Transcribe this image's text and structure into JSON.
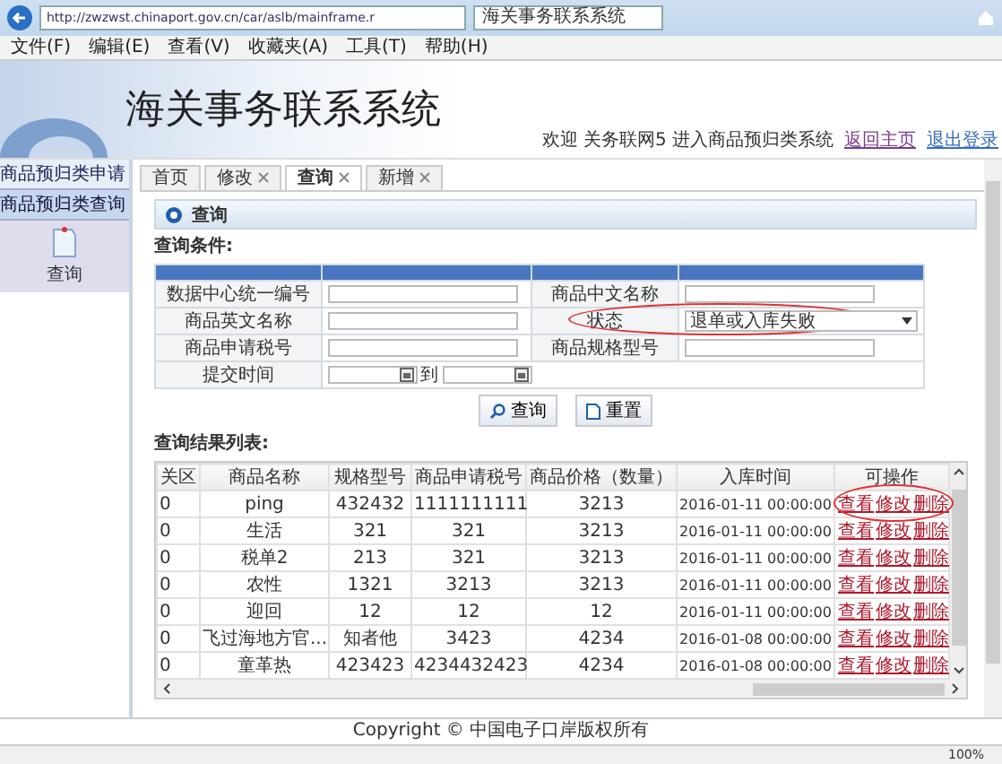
{
  "browser": {
    "url": "http://zwzwst.chinaport.gov.cn/car/aslb/mainframe.r",
    "tab_title": "海关事务联系系统",
    "menu": [
      "文件(F)",
      "编辑(E)",
      "查看(V)",
      "收藏夹(A)",
      "工具(T)",
      "帮助(H)"
    ],
    "zoom": "100%"
  },
  "header": {
    "title": "海关事务联系系统",
    "welcome": "欢迎 关务联网5 进入商品预归类系统",
    "links": [
      "返回主页",
      "退出登录"
    ]
  },
  "sidebar": {
    "items": [
      {
        "label": "商品预归类申请",
        "selected": false
      },
      {
        "label": "商品预归类查询",
        "selected": true
      }
    ],
    "tool": {
      "label": "查询"
    }
  },
  "tabs": [
    {
      "label": "首页",
      "closable": false,
      "selected": false
    },
    {
      "label": "修改",
      "closable": true,
      "selected": false
    },
    {
      "label": "查询",
      "closable": true,
      "selected": true
    },
    {
      "label": "新增",
      "closable": true,
      "selected": false
    }
  ],
  "panel_title": "查询",
  "form": {
    "title": "查询条件:",
    "rows": [
      {
        "cells": [
          {
            "label": "数据中心统一编号",
            "kind": "text",
            "circled": false
          },
          {
            "label": "商品中文名称",
            "kind": "text",
            "circled": false
          }
        ]
      },
      {
        "cells": [
          {
            "label": "商品英文名称",
            "kind": "text",
            "circled": false
          },
          {
            "label": "状态",
            "kind": "select",
            "value": "退单或入库失败",
            "circled": true
          }
        ]
      },
      {
        "cells": [
          {
            "label": "商品申请税号",
            "kind": "text",
            "circled": false
          },
          {
            "label": "商品规格型号",
            "kind": "text",
            "circled": false
          }
        ]
      },
      {
        "cells": [
          {
            "label": "提交时间",
            "kind": "daterange",
            "separator": "到",
            "circled": false
          }
        ]
      }
    ]
  },
  "buttons": [
    {
      "label": "查询",
      "kind": "search"
    },
    {
      "label": "重置",
      "kind": "reset"
    }
  ],
  "results": {
    "title": "查询结果列表:",
    "columns": [
      "关区",
      "商品名称",
      "规格型号",
      "商品申请税号",
      "商品价格（数量）",
      "入库时间",
      "可操作"
    ],
    "rows": [
      {
        "cells": [
          "0",
          "ping",
          "432432",
          "1111111111",
          "3213",
          "2016-01-11 00:00:00"
        ],
        "actions": [
          "查看",
          "修改",
          "删除"
        ],
        "circled": true
      },
      {
        "cells": [
          "0",
          "生活",
          "321",
          "321",
          "3213",
          "2016-01-11 00:00:00"
        ],
        "actions": [
          "查看",
          "修改",
          "删除"
        ],
        "circled": false
      },
      {
        "cells": [
          "0",
          "税单2",
          "213",
          "321",
          "3213",
          "2016-01-11 00:00:00"
        ],
        "actions": [
          "查看",
          "修改",
          "删除"
        ],
        "circled": false
      },
      {
        "cells": [
          "0",
          "农性",
          "1321",
          "3213",
          "3213",
          "2016-01-11 00:00:00"
        ],
        "actions": [
          "查看",
          "修改",
          "删除"
        ],
        "circled": false
      },
      {
        "cells": [
          "0",
          "迎回",
          "12",
          "12",
          "12",
          "2016-01-11 00:00:00"
        ],
        "actions": [
          "查看",
          "修改",
          "删除"
        ],
        "circled": false
      },
      {
        "cells": [
          "0",
          "飞过海地方官...",
          "知者他",
          "3423",
          "4234",
          "2016-01-08 00:00:00"
        ],
        "actions": [
          "查看",
          "修改",
          "删除"
        ],
        "circled": false
      },
      {
        "cells": [
          "0",
          "童革热",
          "423423",
          "4234432423",
          "4234",
          "2016-01-08 00:00:00"
        ],
        "actions": [
          "查看",
          "修改",
          "删除"
        ],
        "circled": false
      }
    ]
  },
  "footer": "Copyright © 中国电子口岸版权所有"
}
